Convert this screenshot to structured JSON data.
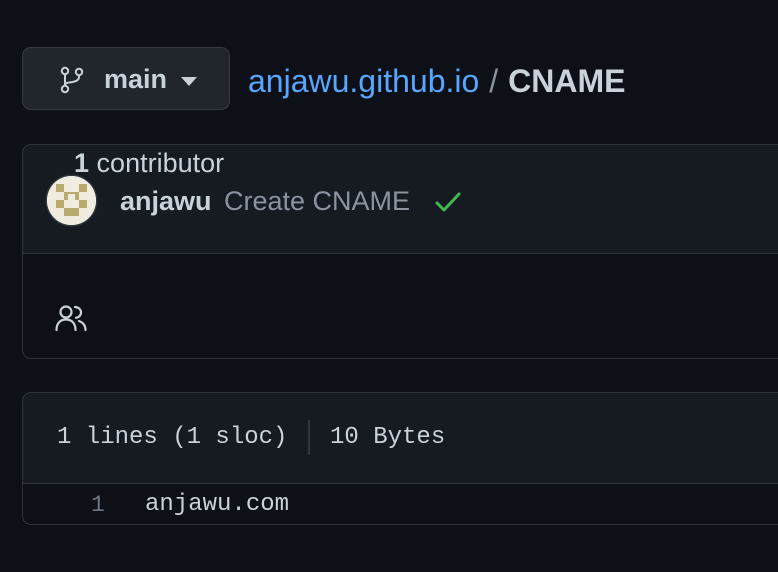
{
  "branch": {
    "icon": "git-branch-icon",
    "name": "main",
    "caret_icon": "triangle-down-icon"
  },
  "breadcrumb": {
    "repo": "anjawu.github.io",
    "separator": "/",
    "file": "CNAME"
  },
  "commit": {
    "avatar_icon": "identicon-avatar",
    "author": "anjawu",
    "message": "Create CNAME",
    "status_icon": "check-icon",
    "status_color": "#3fb950"
  },
  "contributors": {
    "icon": "people-icon",
    "count": "1",
    "label": "contributor"
  },
  "file": {
    "lines_info": "1 lines (1 sloc)",
    "size": "10 Bytes",
    "code_lines": [
      {
        "number": "1",
        "text": "anjawu.com"
      }
    ]
  },
  "colors": {
    "background": "#0d1117",
    "panel": "#161b22",
    "border": "#30363d",
    "link": "#58a6ff",
    "muted": "#8b949e",
    "text": "#c9d1d9"
  }
}
